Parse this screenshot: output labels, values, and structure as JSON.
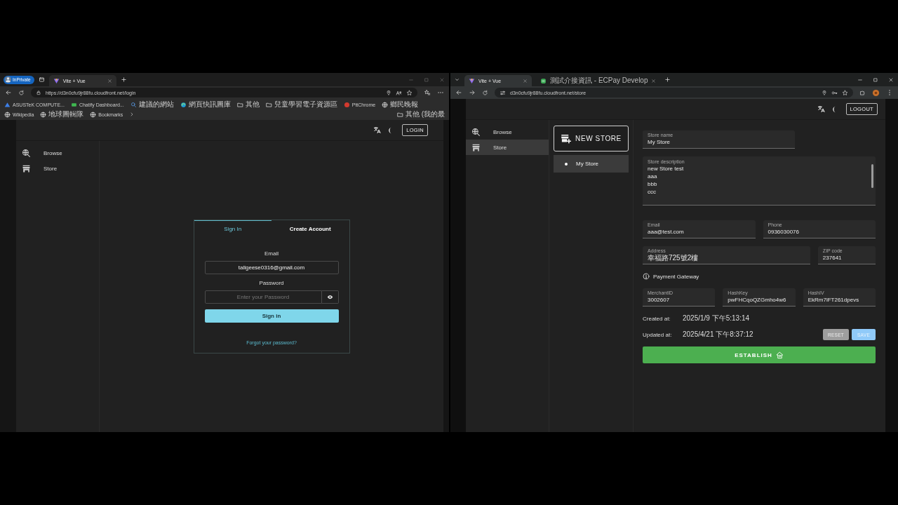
{
  "left_window": {
    "private_badge": "InPrivate",
    "tabs": [
      {
        "title": "Vite + Vue",
        "kind": "triangle",
        "selected": true
      }
    ],
    "address": "https://d3n0cfu9jr88fu.cloudfront.net/login",
    "bookmarks": [
      {
        "label": "ASUSTeK COMPUTE...",
        "kind": "triangle"
      },
      {
        "label": "Chatify Dashboard...",
        "kind": "app"
      },
      {
        "label": "建議的網站",
        "kind": "search"
      },
      {
        "label": "網頁快訊圖庫",
        "kind": "swirl"
      },
      {
        "label": "其他",
        "kind": "folder"
      },
      {
        "label": "兒童學習電子資源區",
        "kind": "folder"
      },
      {
        "label": "PttChrome",
        "kind": "badge"
      },
      {
        "label": "鄉民晚報",
        "kind": "globe"
      },
      {
        "label": "Wikipedia",
        "kind": "globe"
      },
      {
        "label": "地球圖輯隊",
        "kind": "globe"
      },
      {
        "label": "Bookmarks",
        "kind": "globe"
      }
    ],
    "other_bookmarks": "其他 (我的最",
    "app": {
      "account_button": "LOGIN",
      "sidebar": [
        {
          "label": "Browse",
          "kind": "browse",
          "selected": false
        },
        {
          "label": "Store",
          "kind": "store",
          "selected": false
        }
      ],
      "auth_card": {
        "tabs": [
          {
            "label": "Sign In",
            "selected": true
          },
          {
            "label": "Create Account",
            "selected": false
          }
        ],
        "email_label": "Email",
        "email_value": "tallgeese0316@gmail.com",
        "password_label": "Password",
        "password_placeholder": "Enter your Password",
        "submit_button": "Sign in",
        "forgot_link": "Forgot your password?"
      }
    }
  },
  "right_window": {
    "tabs": [
      {
        "title": "Vite + Vue",
        "kind": "triangle",
        "selected": true
      },
      {
        "title": "測試介接資訊 - ECPay Develop",
        "kind": "square",
        "selected": false
      }
    ],
    "address": "d3n0cfu9jr88fu.cloudfront.net/store",
    "app": {
      "account_button": "LOGOUT",
      "sidebar": [
        {
          "label": "Browse",
          "kind": "browse",
          "selected": false
        },
        {
          "label": "Store",
          "kind": "store",
          "selected": true
        }
      ],
      "new_store_button": "NEW STORE",
      "stores": [
        {
          "name": "My Store",
          "selected": true
        }
      ],
      "form": {
        "store_name": {
          "label": "Store name",
          "value": "My Store"
        },
        "store_description": {
          "label": "Store description",
          "value": "new Store test\naaa\nbbb\nccc"
        },
        "email": {
          "label": "Email",
          "value": "aaa@test.com"
        },
        "phone": {
          "label": "Phone",
          "value": "0936030076"
        },
        "address": {
          "label": "Address",
          "value": "幸福路725號2樓"
        },
        "zip_code": {
          "label": "ZIP code",
          "value": "237641"
        },
        "payment_gateway": "Payment Gateway",
        "merchant_id": {
          "label": "MerchantID",
          "value": "3002607"
        },
        "hash_key": {
          "label": "HashKey",
          "value": "pwFHCqoQZGmho4w6"
        },
        "hash_iv": {
          "label": "HashIV",
          "value": "EkRm7iFT261dpevs"
        },
        "created_label": "Created at:",
        "created_value": "2025/1/9 下午5:13:14",
        "updated_label": "Updated at:",
        "updated_value": "2025/4/21 下午8:37:12",
        "reset_button": "RESET",
        "save_button": "SAVE",
        "establish_button": "ESTABLISH"
      }
    }
  }
}
